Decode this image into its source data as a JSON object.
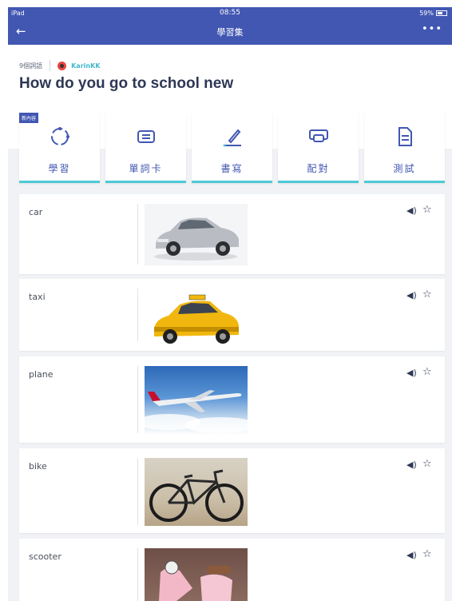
{
  "status": {
    "device": "iPad",
    "time": "08:55",
    "battery": "59%"
  },
  "nav": {
    "back_icon": "←",
    "title": "學習集",
    "more_icon": "•••"
  },
  "meta": {
    "count": "9個詞語",
    "author": "KarinKK"
  },
  "set_title": "How do you go to school new",
  "modes": [
    {
      "label": "學習",
      "icon": "learn-icon",
      "badge": "新內容"
    },
    {
      "label": "單詞卡",
      "icon": "flashcards-icon"
    },
    {
      "label": "書寫",
      "icon": "write-icon"
    },
    {
      "label": "配對",
      "icon": "match-icon"
    },
    {
      "label": "測試",
      "icon": "test-icon"
    }
  ],
  "terms": [
    {
      "term": "car",
      "image": "car-image"
    },
    {
      "term": "taxi",
      "image": "taxi-image"
    },
    {
      "term": "plane",
      "image": "plane-image"
    },
    {
      "term": "bike",
      "image": "bike-image"
    },
    {
      "term": "scooter",
      "image": "scooter-image"
    }
  ],
  "colors": {
    "primary": "#4257b2",
    "accent": "#4fc9d6",
    "text": "#2e3856",
    "background": "#f0f2f5"
  }
}
